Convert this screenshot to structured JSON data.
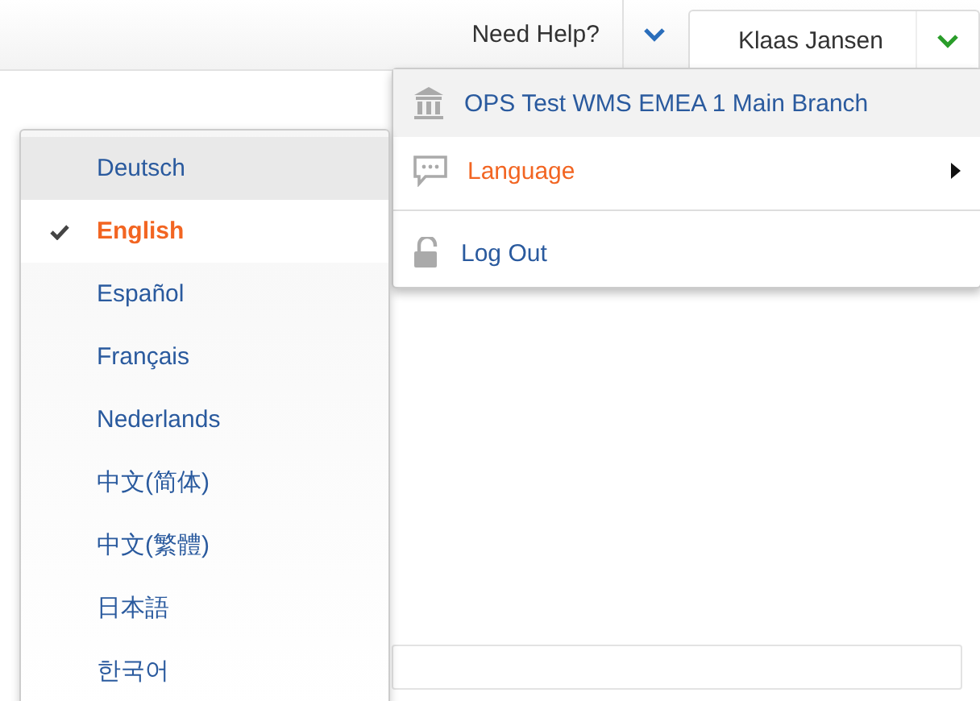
{
  "header": {
    "help_link": "Need Help?",
    "user_name": "Klaas Jansen"
  },
  "user_menu": {
    "items": [
      {
        "kind": "branch",
        "label": "OPS Test WMS EMEA 1 Main Branch",
        "hovered": true,
        "expanded": false
      },
      {
        "kind": "submenu",
        "label": "Language",
        "hovered": false,
        "expanded": true
      },
      {
        "kind": "logout",
        "label": "Log Out",
        "hovered": false,
        "expanded": false
      }
    ]
  },
  "language_menu": {
    "items": [
      {
        "label": "Deutsch",
        "selected": false,
        "hovered": true
      },
      {
        "label": "English",
        "selected": true,
        "hovered": false
      },
      {
        "label": "Español",
        "selected": false,
        "hovered": false
      },
      {
        "label": "Français",
        "selected": false,
        "hovered": false
      },
      {
        "label": "Nederlands",
        "selected": false,
        "hovered": false
      },
      {
        "label": "中文(简体)",
        "selected": false,
        "hovered": false
      },
      {
        "label": "中文(繁體)",
        "selected": false,
        "hovered": false
      },
      {
        "label": "日本語",
        "selected": false,
        "hovered": false
      },
      {
        "label": "한국어",
        "selected": false,
        "hovered": false
      }
    ]
  }
}
